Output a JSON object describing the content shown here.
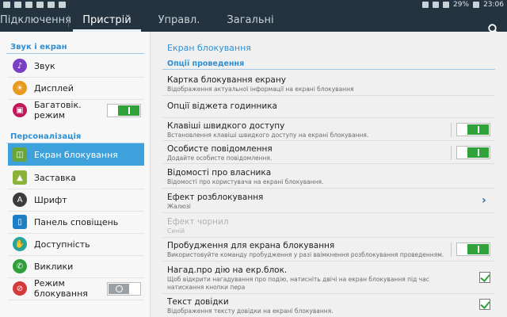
{
  "status": {
    "battery": "29%",
    "time": "23:06"
  },
  "tabs": [
    {
      "label": "Підключення"
    },
    {
      "label": "Пристрій"
    },
    {
      "label": "Управл."
    },
    {
      "label": "Загальні"
    }
  ],
  "sidebar": {
    "section1": "Звук і екран",
    "section2": "Персоналізація",
    "items": [
      {
        "label": "Звук",
        "icon": "speaker-icon",
        "color": "#7b3fc4"
      },
      {
        "label": "Дисплей",
        "icon": "brightness-icon",
        "color": "#e89a1c"
      },
      {
        "label": "Багатовік. режим",
        "icon": "multiwindow-icon",
        "color": "#c2185b",
        "switch": "on"
      },
      {
        "label": "Екран блокування",
        "icon": "lockscreen-icon",
        "color": "#6aa63a"
      },
      {
        "label": "Заставка",
        "icon": "wallpaper-icon",
        "color": "#8bb23a"
      },
      {
        "label": "Шрифт",
        "icon": "font-icon",
        "color": "#3c3c3c"
      },
      {
        "label": "Панель сповіщень",
        "icon": "notification-panel-icon",
        "color": "#1f7fc4"
      },
      {
        "label": "Доступність",
        "icon": "accessibility-icon",
        "color": "#25a59a"
      },
      {
        "label": "Виклики",
        "icon": "phone-icon",
        "color": "#2e9f3a"
      },
      {
        "label": "Режим блокування",
        "icon": "block-mode-icon",
        "color": "#d33a3a",
        "switch": "off"
      }
    ]
  },
  "main": {
    "title": "Екран блокування",
    "subheader": "Опції проведення",
    "rows": [
      {
        "title": "Картка блокування екрану",
        "sub": "Відображення актуальної інформації на екрані блокування"
      },
      {
        "title": "Опції віджета годинника",
        "sub": ""
      },
      {
        "title": "Клавіші швидкого доступу",
        "sub": "Встановлення клавіші швидкого доступу на екрані блокування.",
        "control": "switch"
      },
      {
        "title": "Особисте повідомлення",
        "sub": "Додайте особисте повідомлення.",
        "control": "switch"
      },
      {
        "title": "Відомості про власника",
        "sub": "Відомості про користувача на екрані блокування."
      },
      {
        "title": "Ефект розблокування",
        "sub": "Жалюзі",
        "control": "chevron"
      },
      {
        "title": "Ефект чорнил",
        "sub": "Синій",
        "disabled": true
      },
      {
        "title": "Пробудження для екрана блокування",
        "sub": "Використовуйте команду пробудження у разі ввімкнення розблокування проведенням.",
        "control": "switch"
      },
      {
        "title": "Нагад.про дію на екр.блок.",
        "sub": "Щоб відкрити нагадування про подію, натисніть двічі на екран блокування під час натискання кнопки пера",
        "control": "check"
      },
      {
        "title": "Текст довідки",
        "sub": "Відображення тексту довідки на екрані блокування.",
        "control": "check"
      }
    ]
  }
}
